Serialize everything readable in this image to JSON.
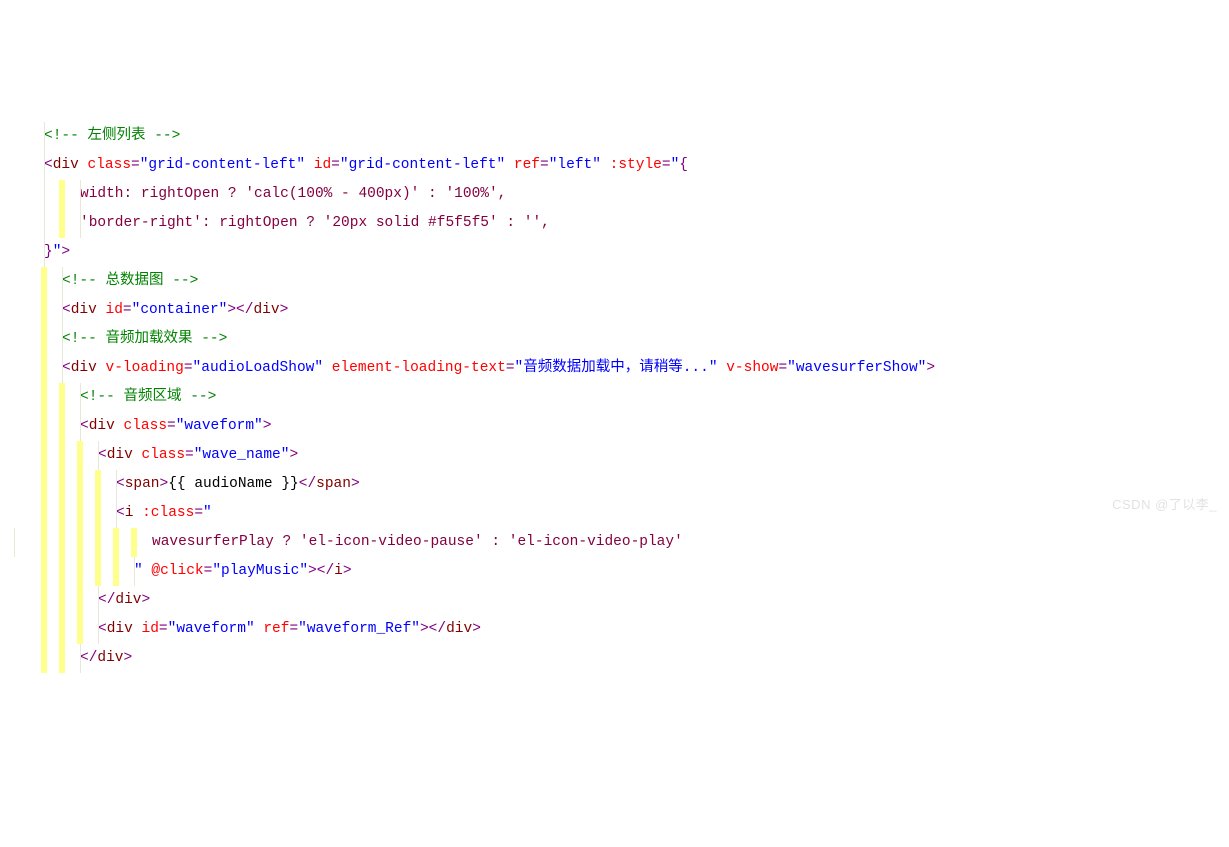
{
  "watermark": "CSDN @了以李_",
  "lines": [
    {
      "indent": 1,
      "hl": [],
      "spans": [
        {
          "t": "<!-- ",
          "c": "c-comment"
        },
        {
          "t": "左侧列表 ",
          "c": "c-comment"
        },
        {
          "t": "-->",
          "c": "c-comment"
        }
      ]
    },
    {
      "indent": 1,
      "hl": [],
      "spans": [
        {
          "t": "<",
          "c": "c-punct"
        },
        {
          "t": "div ",
          "c": "c-tag"
        },
        {
          "t": "class",
          "c": "c-attr"
        },
        {
          "t": "=",
          "c": "c-punct"
        },
        {
          "t": "\"grid-content-left\"",
          "c": "c-value"
        },
        {
          "t": " ",
          "c": "c-text"
        },
        {
          "t": "id",
          "c": "c-attr"
        },
        {
          "t": "=",
          "c": "c-punct"
        },
        {
          "t": "\"grid-content-left\"",
          "c": "c-value"
        },
        {
          "t": " ",
          "c": "c-text"
        },
        {
          "t": "ref",
          "c": "c-attr"
        },
        {
          "t": "=",
          "c": "c-punct"
        },
        {
          "t": "\"left\"",
          "c": "c-value"
        },
        {
          "t": " ",
          "c": "c-text"
        },
        {
          "t": ":style",
          "c": "c-attr"
        },
        {
          "t": "=",
          "c": "c-punct"
        },
        {
          "t": "\"",
          "c": "c-value"
        },
        {
          "t": "{",
          "c": "c-punct"
        }
      ]
    },
    {
      "indent": 3,
      "hl": [
        1
      ],
      "spans": [
        {
          "t": "width: rightOpen ? 'calc(100% - 400px)' : '100%',",
          "c": "c-expr"
        }
      ]
    },
    {
      "indent": 3,
      "hl": [
        1
      ],
      "spans": [
        {
          "t": "'border-right': rightOpen ? '20px solid #f5f5f5' : '',",
          "c": "c-expr"
        }
      ]
    },
    {
      "indent": 1,
      "hl": [],
      "spans": [
        {
          "t": "}",
          "c": "c-punct"
        },
        {
          "t": "\"",
          "c": "c-value"
        },
        {
          "t": ">",
          "c": "c-punct"
        }
      ]
    },
    {
      "indent": 2,
      "hl": [
        0
      ],
      "spans": [
        {
          "t": "<!-- ",
          "c": "c-comment"
        },
        {
          "t": "总数据图 ",
          "c": "c-comment"
        },
        {
          "t": "-->",
          "c": "c-comment"
        }
      ]
    },
    {
      "indent": 2,
      "hl": [
        0
      ],
      "spans": [
        {
          "t": "<",
          "c": "c-punct"
        },
        {
          "t": "div ",
          "c": "c-tag"
        },
        {
          "t": "id",
          "c": "c-attr"
        },
        {
          "t": "=",
          "c": "c-punct"
        },
        {
          "t": "\"container\"",
          "c": "c-value"
        },
        {
          "t": "></",
          "c": "c-punct"
        },
        {
          "t": "div",
          "c": "c-tag"
        },
        {
          "t": ">",
          "c": "c-punct"
        }
      ]
    },
    {
      "indent": 2,
      "hl": [
        0
      ],
      "spans": [
        {
          "t": "<!-- ",
          "c": "c-comment"
        },
        {
          "t": "音频加载效果 ",
          "c": "c-comment"
        },
        {
          "t": "-->",
          "c": "c-comment"
        }
      ]
    },
    {
      "indent": 2,
      "hl": [
        0
      ],
      "spans": [
        {
          "t": "<",
          "c": "c-punct"
        },
        {
          "t": "div ",
          "c": "c-tag"
        },
        {
          "t": "v-loading",
          "c": "c-attr"
        },
        {
          "t": "=",
          "c": "c-punct"
        },
        {
          "t": "\"audioLoadShow\"",
          "c": "c-value"
        },
        {
          "t": " ",
          "c": "c-text"
        },
        {
          "t": "element-loading-text",
          "c": "c-attr"
        },
        {
          "t": "=",
          "c": "c-punct"
        },
        {
          "t": "\"音频数据加载中，请稍等...\"",
          "c": "c-value"
        },
        {
          "t": " ",
          "c": "c-text"
        },
        {
          "t": "v-show",
          "c": "c-attr"
        },
        {
          "t": "=",
          "c": "c-punct"
        },
        {
          "t": "\"wavesurferShow\"",
          "c": "c-value"
        },
        {
          "t": ">",
          "c": "c-punct"
        }
      ]
    },
    {
      "indent": 3,
      "hl": [
        0,
        1
      ],
      "spans": [
        {
          "t": "<!-- ",
          "c": "c-comment"
        },
        {
          "t": "音频区域 ",
          "c": "c-comment"
        },
        {
          "t": "-->",
          "c": "c-comment"
        }
      ]
    },
    {
      "indent": 3,
      "hl": [
        0,
        1
      ],
      "spans": [
        {
          "t": "<",
          "c": "c-punct"
        },
        {
          "t": "div ",
          "c": "c-tag"
        },
        {
          "t": "class",
          "c": "c-attr"
        },
        {
          "t": "=",
          "c": "c-punct"
        },
        {
          "t": "\"waveform\"",
          "c": "c-value"
        },
        {
          "t": ">",
          "c": "c-punct"
        }
      ]
    },
    {
      "indent": 4,
      "hl": [
        0,
        1,
        2
      ],
      "spans": [
        {
          "t": "<",
          "c": "c-punct"
        },
        {
          "t": "div ",
          "c": "c-tag"
        },
        {
          "t": "class",
          "c": "c-attr"
        },
        {
          "t": "=",
          "c": "c-punct"
        },
        {
          "t": "\"wave_name\"",
          "c": "c-value"
        },
        {
          "t": ">",
          "c": "c-punct"
        }
      ]
    },
    {
      "indent": 5,
      "hl": [
        0,
        1,
        2,
        3
      ],
      "spans": [
        {
          "t": "<",
          "c": "c-punct"
        },
        {
          "t": "span",
          "c": "c-tag"
        },
        {
          "t": ">",
          "c": "c-punct"
        },
        {
          "t": "{{ audioName }}",
          "c": "c-text"
        },
        {
          "t": "</",
          "c": "c-punct"
        },
        {
          "t": "span",
          "c": "c-tag"
        },
        {
          "t": ">",
          "c": "c-punct"
        }
      ]
    },
    {
      "indent": 5,
      "hl": [
        0,
        1,
        2,
        3
      ],
      "spans": [
        {
          "t": "<",
          "c": "c-punct"
        },
        {
          "t": "i ",
          "c": "c-tag"
        },
        {
          "t": ":class",
          "c": "c-attr"
        },
        {
          "t": "=",
          "c": "c-punct"
        },
        {
          "t": "\"",
          "c": "c-value"
        }
      ]
    },
    {
      "indent": 7,
      "hl": [
        0,
        1,
        2,
        3,
        4,
        5
      ],
      "spans": [
        {
          "t": "wavesurferPlay ? 'el-icon-video-pause' : 'el-icon-video-play'",
          "c": "c-expr"
        }
      ]
    },
    {
      "indent": 6,
      "hl": [
        0,
        1,
        2,
        3,
        4
      ],
      "spans": [
        {
          "t": "\"",
          "c": "c-value"
        },
        {
          "t": " ",
          "c": "c-text"
        },
        {
          "t": "@click",
          "c": "c-attr"
        },
        {
          "t": "=",
          "c": "c-punct"
        },
        {
          "t": "\"playMusic\"",
          "c": "c-value"
        },
        {
          "t": "></",
          "c": "c-punct"
        },
        {
          "t": "i",
          "c": "c-tag"
        },
        {
          "t": ">",
          "c": "c-punct"
        }
      ]
    },
    {
      "indent": 4,
      "hl": [
        0,
        1,
        2
      ],
      "spans": [
        {
          "t": "</",
          "c": "c-punct"
        },
        {
          "t": "div",
          "c": "c-tag"
        },
        {
          "t": ">",
          "c": "c-punct"
        }
      ]
    },
    {
      "indent": 4,
      "hl": [
        0,
        1,
        2
      ],
      "spans": [
        {
          "t": "<",
          "c": "c-punct"
        },
        {
          "t": "div ",
          "c": "c-tag"
        },
        {
          "t": "id",
          "c": "c-attr"
        },
        {
          "t": "=",
          "c": "c-punct"
        },
        {
          "t": "\"waveform\"",
          "c": "c-value"
        },
        {
          "t": " ",
          "c": "c-text"
        },
        {
          "t": "ref",
          "c": "c-attr"
        },
        {
          "t": "=",
          "c": "c-punct"
        },
        {
          "t": "\"waveform_Ref\"",
          "c": "c-value"
        },
        {
          "t": "></",
          "c": "c-punct"
        },
        {
          "t": "div",
          "c": "c-tag"
        },
        {
          "t": ">",
          "c": "c-punct"
        }
      ]
    },
    {
      "indent": 3,
      "hl": [
        0,
        1
      ],
      "spans": [
        {
          "t": "</",
          "c": "c-punct"
        },
        {
          "t": "div",
          "c": "c-tag"
        },
        {
          "t": ">",
          "c": "c-punct"
        }
      ]
    }
  ]
}
